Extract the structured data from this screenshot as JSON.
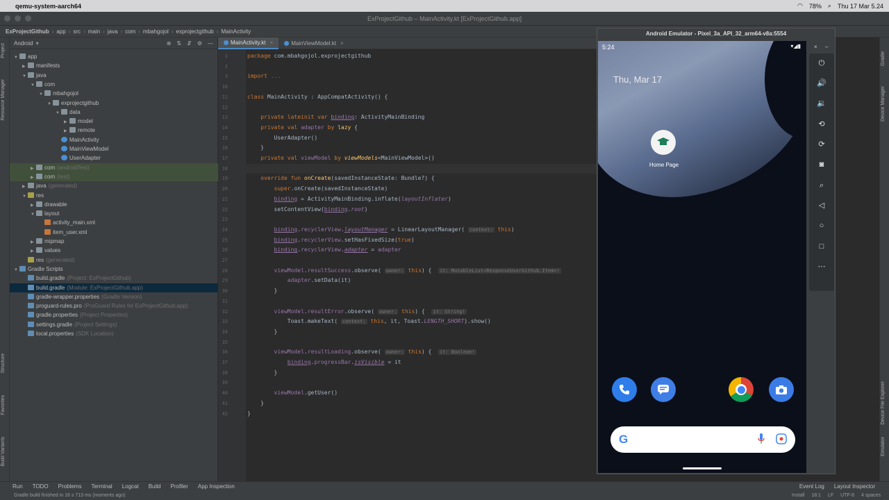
{
  "menubar": {
    "app": "qemu-system-aarch64",
    "battery": "78%",
    "datetime": "Thu 17 Mar  5.24"
  },
  "window": {
    "title": "ExProjectGithub – MainActivity.kt [ExProjectGithub.app]"
  },
  "breadcrumb": [
    "ExProjectGithub",
    "app",
    "src",
    "main",
    "java",
    "com",
    "mbahgojol",
    "exprojectgithub",
    "MainActivity"
  ],
  "project": {
    "view": "Android",
    "tree": [
      {
        "label": "app",
        "depth": 0,
        "icon": "folder",
        "arrow": "▼"
      },
      {
        "label": "manifests",
        "depth": 1,
        "icon": "folder",
        "arrow": "▶"
      },
      {
        "label": "java",
        "depth": 1,
        "icon": "folder",
        "arrow": "▼"
      },
      {
        "label": "com",
        "depth": 2,
        "icon": "folder",
        "arrow": "▼"
      },
      {
        "label": "mbahgojol",
        "depth": 3,
        "icon": "folder",
        "arrow": "▼"
      },
      {
        "label": "exprojectgithub",
        "depth": 4,
        "icon": "folder",
        "arrow": "▼"
      },
      {
        "label": "data",
        "depth": 5,
        "icon": "folder",
        "arrow": "▼"
      },
      {
        "label": "model",
        "depth": 6,
        "icon": "folder",
        "arrow": "▶"
      },
      {
        "label": "remote",
        "depth": 6,
        "icon": "folder",
        "arrow": "▶"
      },
      {
        "label": "MainActivity",
        "depth": 5,
        "icon": "kt",
        "arrow": ""
      },
      {
        "label": "MainViewModel",
        "depth": 5,
        "icon": "kt",
        "arrow": ""
      },
      {
        "label": "UserAdapter",
        "depth": 5,
        "icon": "kt",
        "arrow": ""
      },
      {
        "label": "com",
        "note": "(androidTest)",
        "depth": 2,
        "icon": "folder",
        "arrow": "▶",
        "hl": true
      },
      {
        "label": "com",
        "note": "(test)",
        "depth": 2,
        "icon": "folder",
        "arrow": "▶",
        "hl": true
      },
      {
        "label": "java",
        "note": "(generated)",
        "depth": 1,
        "icon": "folder",
        "arrow": "▶"
      },
      {
        "label": "res",
        "depth": 1,
        "icon": "res",
        "arrow": "▼"
      },
      {
        "label": "drawable",
        "depth": 2,
        "icon": "folder",
        "arrow": "▶"
      },
      {
        "label": "layout",
        "depth": 2,
        "icon": "folder",
        "arrow": "▼"
      },
      {
        "label": "activity_main.xml",
        "depth": 3,
        "icon": "xml",
        "arrow": ""
      },
      {
        "label": "item_user.xml",
        "depth": 3,
        "icon": "xml",
        "arrow": ""
      },
      {
        "label": "mipmap",
        "depth": 2,
        "icon": "folder",
        "arrow": "▶"
      },
      {
        "label": "values",
        "depth": 2,
        "icon": "folder",
        "arrow": "▶"
      },
      {
        "label": "res",
        "note": "(generated)",
        "depth": 1,
        "icon": "res",
        "arrow": ""
      },
      {
        "label": "Gradle Scripts",
        "depth": 0,
        "icon": "gr",
        "arrow": "▼"
      },
      {
        "label": "build.gradle",
        "note": "(Project: ExProjectGithub)",
        "depth": 1,
        "icon": "gr",
        "arrow": ""
      },
      {
        "label": "build.gradle",
        "note": "(Module: ExProjectGithub.app)",
        "depth": 1,
        "icon": "gr",
        "arrow": "",
        "sel": true
      },
      {
        "label": "gradle-wrapper.properties",
        "note": "(Gradle Version)",
        "depth": 1,
        "icon": "gr",
        "arrow": ""
      },
      {
        "label": "proguard-rules.pro",
        "note": "(ProGuard Rules for ExProjectGithub.app)",
        "depth": 1,
        "icon": "gr",
        "arrow": ""
      },
      {
        "label": "gradle.properties",
        "note": "(Project Properties)",
        "depth": 1,
        "icon": "gr",
        "arrow": ""
      },
      {
        "label": "settings.gradle",
        "note": "(Project Settings)",
        "depth": 1,
        "icon": "gr",
        "arrow": ""
      },
      {
        "label": "local.properties",
        "note": "(SDK Location)",
        "depth": 1,
        "icon": "gr",
        "arrow": ""
      }
    ]
  },
  "tabs": [
    {
      "label": "MainActivity.kt",
      "active": true
    },
    {
      "label": "MainViewModel.kt",
      "active": false
    }
  ],
  "code": [
    {
      "n": "1",
      "html": "<span class='kw'>package</span> com.mbahgojol.exprojectgithub"
    },
    {
      "n": "2",
      "html": ""
    },
    {
      "n": "3",
      "html": "<span class='kw'>import</span> <span style='color:#787878'>...</span>"
    },
    {
      "n": "10",
      "html": ""
    },
    {
      "n": "11",
      "html": "<span class='kw'>class</span> MainActivity : AppCompatActivity() {"
    },
    {
      "n": "12",
      "html": ""
    },
    {
      "n": "13",
      "html": "    <span class='kw'>private lateinit var</span> <span class='prop und'>binding</span>: ActivityMainBinding"
    },
    {
      "n": "14",
      "html": "    <span class='kw'>private val</span> <span class='prop'>adapter</span> <span class='kw'>by</span> <span class='fn'>lazy</span> {"
    },
    {
      "n": "15",
      "html": "        UserAdapter()"
    },
    {
      "n": "16",
      "html": "    }"
    },
    {
      "n": "17",
      "html": "    <span class='kw'>private val</span> <span class='prop'>viewModel</span> <span class='kw'>by</span> <span class='fn' style='font-style:italic'>viewModels</span>&lt;MainViewModel&gt;()"
    },
    {
      "n": "18",
      "html": ""
    },
    {
      "n": "19",
      "html": "    <span class='kw'>override fun</span> <span class='fn'>onCreate</span>(savedInstanceState: Bundle?) {"
    },
    {
      "n": "20",
      "html": "        <span class='kw'>super</span>.onCreate(savedInstanceState)"
    },
    {
      "n": "21",
      "html": "        <span class='prop und'>binding</span> = ActivityMainBinding.inflate(<span class='it'>layoutInflater</span>)"
    },
    {
      "n": "22",
      "html": "        setContentView(<span class='prop und'>binding</span>.<span class='it'>root</span>)"
    },
    {
      "n": "23",
      "html": ""
    },
    {
      "n": "24",
      "html": "        <span class='prop und'>binding</span>.<span class='prop'>recyclerView</span>.<span class='it und'>layoutManager</span> = LinearLayoutManager( <span class='hint'>context:</span> <span class='kw'>this</span>)"
    },
    {
      "n": "25",
      "html": "        <span class='prop und'>binding</span>.<span class='prop'>recyclerView</span>.setHasFixedSize(<span class='kw'>true</span>)"
    },
    {
      "n": "26",
      "html": "        <span class='prop und'>binding</span>.<span class='prop'>recyclerView</span>.<span class='it und'>adapter</span> = <span class='prop'>adapter</span>"
    },
    {
      "n": "27",
      "html": ""
    },
    {
      "n": "28",
      "html": "        <span class='prop'>viewModel</span>.<span class='prop'>resultSuccess</span>.observe( <span class='hint'>owner:</span> <span class='kw'>this</span>) {  <span class='hint'>it: MutableList&lt;ResponseUserGithub.Item&gt;!</span>"
    },
    {
      "n": "29",
      "html": "            <span class='prop'>adapter</span>.setData(it)"
    },
    {
      "n": "30",
      "html": "        }"
    },
    {
      "n": "31",
      "html": ""
    },
    {
      "n": "32",
      "html": "        <span class='prop'>viewModel</span>.<span class='prop'>resultError</span>.observe( <span class='hint'>owner:</span> <span class='kw'>this</span>) {  <span class='hint'>it: String!</span>"
    },
    {
      "n": "33",
      "html": "            Toast.makeText( <span class='hint'>context:</span> <span class='kw'>this</span>, it, Toast.<span class='it'>LENGTH_SHORT</span>).show()"
    },
    {
      "n": "34",
      "html": "        }"
    },
    {
      "n": "35",
      "html": ""
    },
    {
      "n": "36",
      "html": "        <span class='prop'>viewModel</span>.<span class='prop'>resultLoading</span>.observe( <span class='hint'>owner:</span> <span class='kw'>this</span>) {  <span class='hint'>it: Boolean!</span>"
    },
    {
      "n": "37",
      "html": "            <span class='prop und'>binding</span>.<span class='prop'>progressBar</span>.<span class='it und'>isVisible</span> = it"
    },
    {
      "n": "38",
      "html": "        }"
    },
    {
      "n": "39",
      "html": ""
    },
    {
      "n": "40",
      "html": "        <span class='prop'>viewModel</span>.getUser()"
    },
    {
      "n": "41",
      "html": "    }"
    },
    {
      "n": "42",
      "html": "}"
    }
  ],
  "emulator": {
    "title": "Android Emulator - Pixel_3a_API_32_arm64-v8a:5554",
    "time": "5:24",
    "date": "Thu, Mar 17",
    "home_label": "Home Page"
  },
  "bottom_tools": [
    "Run",
    "TODO",
    "Problems",
    "Terminal",
    "Logcat",
    "Build",
    "Profiler",
    "App Inspection",
    "Event Log",
    "Layout Inspector"
  ],
  "status": {
    "message": "Gradle build finished in 16 s 713 ms (moments ago)",
    "install": "Install",
    "position": "18:1",
    "lf": "LF",
    "encoding": "UTF-8",
    "indent": "4 spaces"
  }
}
